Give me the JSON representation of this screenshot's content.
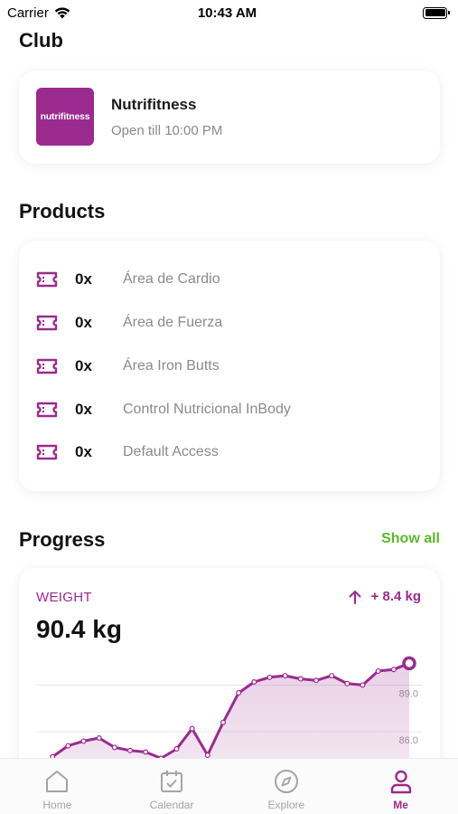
{
  "status": {
    "carrier": "Carrier",
    "time": "10:43 AM"
  },
  "club": {
    "section_title": "Club",
    "logo_text": "nutrifitness",
    "name": "Nutrifitness",
    "hours": "Open till 10:00 PM"
  },
  "products": {
    "section_title": "Products",
    "items": [
      {
        "count": "0x",
        "name": "Área de Cardio"
      },
      {
        "count": "0x",
        "name": "Área de Fuerza"
      },
      {
        "count": "0x",
        "name": "Área Iron Butts"
      },
      {
        "count": "0x",
        "name": "Control Nutricional InBody"
      },
      {
        "count": "0x",
        "name": "Default Access"
      }
    ]
  },
  "progress": {
    "section_title": "Progress",
    "show_all": "Show all",
    "metric_label": "WEIGHT",
    "change": "+ 8.4 kg",
    "value": "90.4 kg"
  },
  "chart_data": {
    "type": "area",
    "y_tick_labels": [
      "89.0",
      "86.0"
    ],
    "y_ticks": [
      89.0,
      86.0
    ],
    "ylim": [
      82.0,
      91.0
    ],
    "grid": true,
    "x": [
      1,
      2,
      3,
      4,
      5,
      6,
      7,
      8,
      9,
      10,
      11,
      12,
      13,
      14,
      15,
      16,
      17,
      18,
      19,
      20,
      21,
      22,
      23,
      24,
      25
    ],
    "y": [
      83.0,
      84.4,
      85.1,
      85.4,
      85.6,
      85.0,
      84.8,
      84.7,
      84.3,
      84.9,
      86.2,
      84.5,
      86.6,
      88.5,
      89.2,
      89.5,
      89.6,
      89.4,
      89.3,
      89.6,
      89.1,
      89.0,
      89.9,
      90.0,
      90.4
    ],
    "color": "#9b2a8e"
  },
  "tabs": [
    {
      "label": "Home",
      "icon": "home-icon",
      "active": false
    },
    {
      "label": "Calendar",
      "icon": "calendar-icon",
      "active": false
    },
    {
      "label": "Explore",
      "icon": "compass-icon",
      "active": false
    },
    {
      "label": "Me",
      "icon": "person-icon",
      "active": true
    }
  ],
  "colors": {
    "brand": "#9b2a8e",
    "accent_green": "#5cb82a",
    "muted_text": "#8a8a8e"
  }
}
